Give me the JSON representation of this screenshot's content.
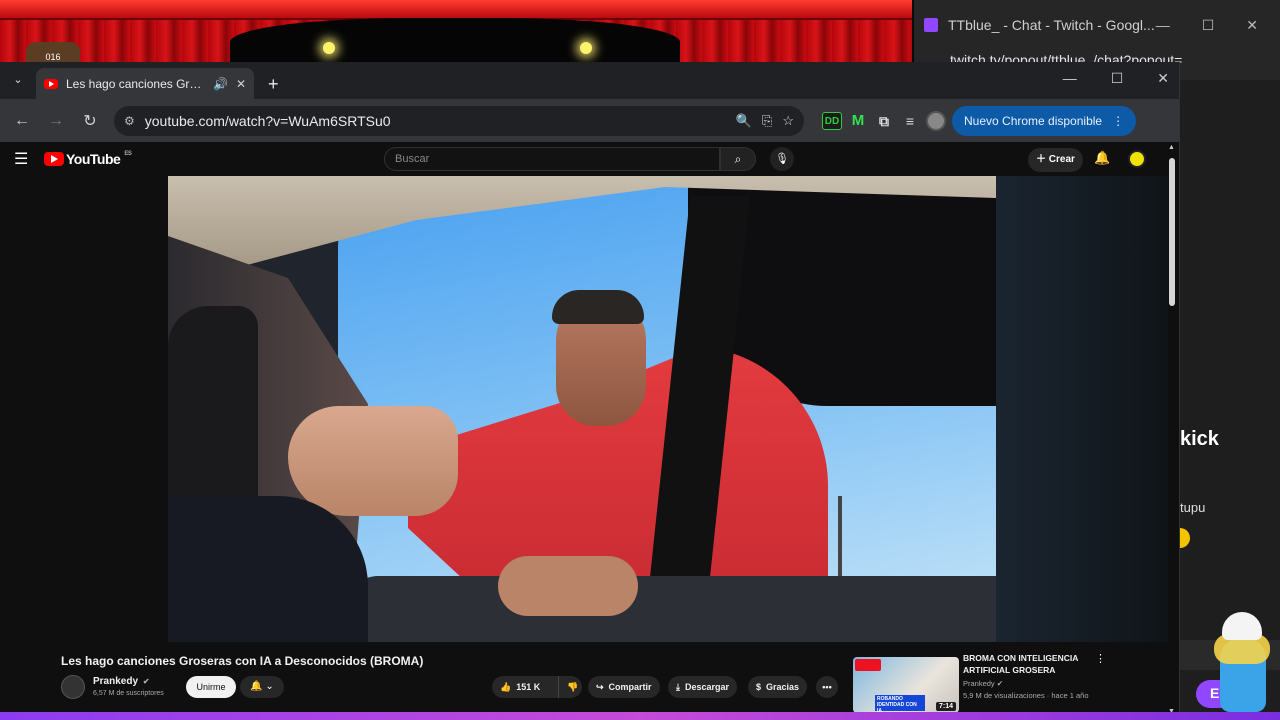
{
  "overlay": {
    "badge_text": "016"
  },
  "twitch_window": {
    "title": "TTblue_ - Chat - Twitch - Googl...",
    "url": "twitch.tv/popout/ttblue_/chat?popout=",
    "minimize": "—",
    "maximize": "☐",
    "close": "✕",
    "chat_word": "kick",
    "chat_fragment": "tupu",
    "chat_button_partial": "E"
  },
  "chrome": {
    "tab_list_icon": "⌄",
    "tab_title": "Les hago canciones Groseras con IA a Desconocidos (BROMA)",
    "tab_audio_icon": "🔊",
    "tab_close": "✕",
    "new_tab": "+",
    "minimize": "—",
    "maximize": "☐",
    "close": "✕",
    "back": "←",
    "forward": "→",
    "reload": "↻",
    "url": "youtube.com/watch?v=WuAm6SRTSu0",
    "ext_dd_label": "DD",
    "ext_m_label": "M",
    "update_label": "Nuevo Chrome disponible",
    "update_menu": "⋮"
  },
  "youtube": {
    "logo_text": "YouTube",
    "country_code": "ES",
    "search_placeholder": "Buscar",
    "create_label": "Crear",
    "video_title": "Les hago canciones Groseras con IA a Desconocidos (BROMA)",
    "channel_name": "Prankedy",
    "subscribers": "6,57 M de suscriptores",
    "join_label": "Unirme",
    "likes": "151 K",
    "share_label": "Compartir",
    "download_label": "Descargar",
    "thanks_label": "Gracias",
    "more_label": "•••",
    "recommendation": {
      "title": "BROMA CON INTELIGENCIA ARTIFICIAL GROSERA",
      "channel": "Prankedy",
      "meta": "5,9 M de visualizaciones · hace 1 año",
      "duration": "7:14",
      "thumb_caption": "ROBANDO IDENTIDAD CON IA"
    }
  },
  "colors": {
    "accent_update": "#0d5aa7",
    "youtube_red": "#ff0000",
    "twitch_purple": "#9146ff"
  }
}
